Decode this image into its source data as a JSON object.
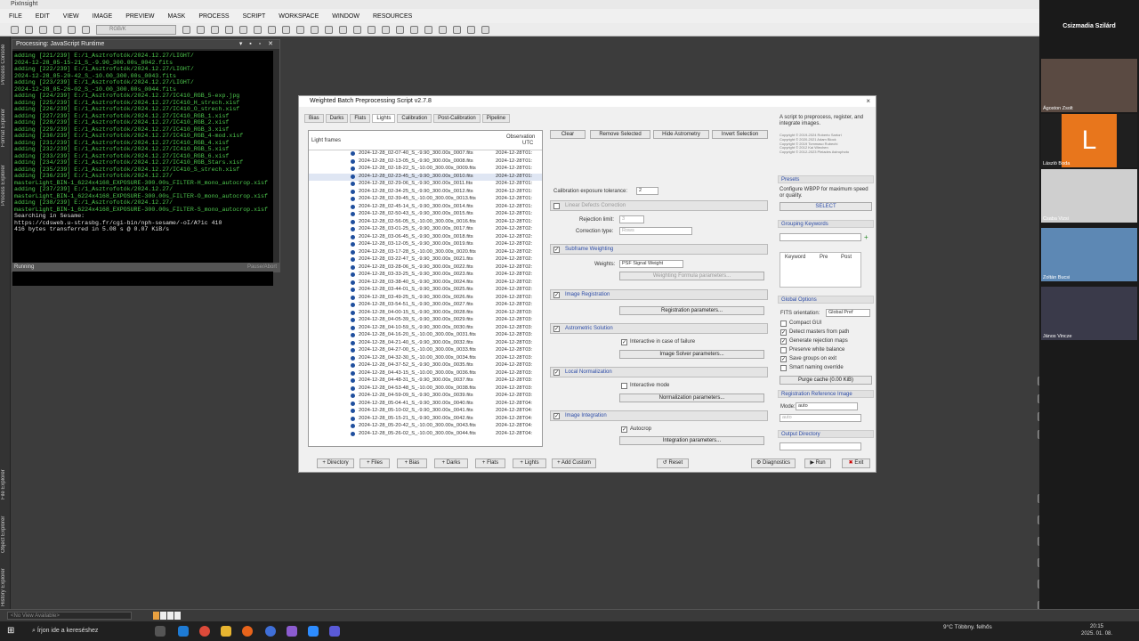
{
  "app": {
    "title": "PixInsight"
  },
  "menu": [
    "FILE",
    "EDIT",
    "VIEW",
    "IMAGE",
    "PREVIEW",
    "MASK",
    "PROCESS",
    "SCRIPT",
    "WORKSPACE",
    "WINDOW",
    "RESOURCES"
  ],
  "toolbar": {
    "channel_select": "RGB/K"
  },
  "left_tabs": [
    "Process Console",
    "Format Explorer",
    "Process Explorer",
    "File Explorer",
    "Object Explorer",
    "History Explorer"
  ],
  "console": {
    "title": "Processing: JavaScript Runtime",
    "lines": [
      "adding [221/239] E:/1_Asztrofotók/2024.12.27/LIGHT/",
      "2024-12-28_05-15-21_S_-9.90_300.00s_0042.fits",
      "adding [222/239] E:/1_Asztrofotók/2024.12.27/LIGHT/",
      "2024-12-28_05-20-42_S_-10.00_300.00s_0043.fits",
      "adding [223/239] E:/1_Asztrofotók/2024.12.27/LIGHT/",
      "2024-12-28_05-26-02_S_-10.00_300.00s_0044.fits",
      "adding [224/239] E:/1_Asztrofotók/2024.12.27/IC410_RGB_5-exp.jpg",
      "adding [225/239] E:/1_Asztrofotók/2024.12.27/IC410_H_strech.xisf",
      "adding [226/239] E:/1_Asztrofotók/2024.12.27/IC410_O_strech.xisf",
      "adding [227/239] E:/1_Asztrofotók/2024.12.27/IC410_RGB_1.xisf",
      "adding [228/239] E:/1_Asztrofotók/2024.12.27/IC410_RGB_2.xisf",
      "adding [229/239] E:/1_Asztrofotók/2024.12.27/IC410_RGB_3.xisf",
      "adding [230/239] E:/1_Asztrofotók/2024.12.27/IC410_RGB_4-mod.xisf",
      "adding [231/239] E:/1_Asztrofotók/2024.12.27/IC410_RGB_4.xisf",
      "adding [232/239] E:/1_Asztrofotók/2024.12.27/IC410_RGB_5.xisf",
      "adding [233/239] E:/1_Asztrofotók/2024.12.27/IC410_RGB_6.xisf",
      "adding [234/239] E:/1_Asztrofotók/2024.12.27/IC410_RGB_Stars.xisf",
      "adding [235/239] E:/1_Asztrofotók/2024.12.27/IC410_S_strech.xisf",
      "adding [236/239] E:/1_Asztrofotók/2024.12.27/",
      "masterLight_BIN-1_6224x4168_EXPOSURE-300.00s_FILTER-H_mono_autocrop.xisf",
      "adding [237/239] E:/1_Asztrofotók/2024.12.27/",
      "masterLight_BIN-1_6224x4168_EXPOSURE-300.00s_FILTER-O_mono_autocrop.xisf",
      "adding [238/239] E:/1_Asztrofotók/2024.12.27/",
      "masterLight_BIN-1_6224x4168_EXPOSURE-300.00s_FILTER-S_mono_autocrop.xisf",
      "",
      "Searching in Sesame:",
      "https://cdsweb.u-strasbg.fr/cgi-bin/nph-sesame/-oI/A?ic 410",
      "416 bytes transferred in 5.08 s @ 0.07 KiB/s"
    ],
    "status": "Running",
    "pause": "Pause/Abort"
  },
  "dialog": {
    "title": "Weighted Batch Preprocessing Script v2.7.8",
    "close": "×",
    "tabs": [
      "Bias",
      "Darks",
      "Flats",
      "Lights",
      "Calibration",
      "Post-Calibration",
      "Pipeline"
    ],
    "list_header": {
      "frames": "Light frames",
      "obs": "Observation",
      "utc": "UTC"
    },
    "frames": [
      [
        "2024-12-28_02-07-40_S_-9.90_300.00s_0007.fits",
        "2024-12-28T01:"
      ],
      [
        "2024-12-28_02-13-05_S_-9.90_300.00s_0008.fits",
        "2024-12-28T01:"
      ],
      [
        "2024-12-28_02-18-22_S_-10.00_300.00s_0009.fits",
        "2024-12-28T01:"
      ],
      [
        "2024-12-28_02-23-45_S_-9.90_300.00s_0010.fits",
        "2024-12-28T01:"
      ],
      [
        "2024-12-28_02-29-06_S_-9.90_300.00s_0011.fits",
        "2024-12-28T01:"
      ],
      [
        "2024-12-28_02-34-25_S_-9.90_300.00s_0012.fits",
        "2024-12-28T01:"
      ],
      [
        "2024-12-28_02-39-45_S_-10.00_300.00s_0013.fits",
        "2024-12-28T01:"
      ],
      [
        "2024-12-28_02-45-14_S_-9.90_300.00s_0014.fits",
        "2024-12-28T01:"
      ],
      [
        "2024-12-28_02-50-43_S_-9.90_300.00s_0015.fits",
        "2024-12-28T01:"
      ],
      [
        "2024-12-28_02-56-05_S_-10.00_300.00s_0016.fits",
        "2024-12-28T01:"
      ],
      [
        "2024-12-28_03-01-25_S_-9.90_300.00s_0017.fits",
        "2024-12-28T02:"
      ],
      [
        "2024-12-28_03-06-45_S_-9.90_300.00s_0018.fits",
        "2024-12-28T02:"
      ],
      [
        "2024-12-28_03-12-05_S_-9.90_300.00s_0019.fits",
        "2024-12-28T02:"
      ],
      [
        "2024-12-28_03-17-28_S_-10.00_300.00s_0020.fits",
        "2024-12-28T02:"
      ],
      [
        "2024-12-28_03-22-47_S_-9.90_300.00s_0021.fits",
        "2024-12-28T02:"
      ],
      [
        "2024-12-28_03-28-06_S_-9.90_300.00s_0022.fits",
        "2024-12-28T02:"
      ],
      [
        "2024-12-28_03-33-25_S_-9.90_300.00s_0023.fits",
        "2024-12-28T02:"
      ],
      [
        "2024-12-28_03-38-40_S_-9.90_300.00s_0024.fits",
        "2024-12-28T02:"
      ],
      [
        "2024-12-28_03-44-01_S_-9.90_300.00s_0025.fits",
        "2024-12-28T02:"
      ],
      [
        "2024-12-28_03-49-25_S_-9.90_300.00s_0026.fits",
        "2024-12-28T02:"
      ],
      [
        "2024-12-28_03-54-51_S_-9.90_300.00s_0027.fits",
        "2024-12-28T02:"
      ],
      [
        "2024-12-28_04-00-15_S_-9.90_300.00s_0028.fits",
        "2024-12-28T03:"
      ],
      [
        "2024-12-28_04-05-39_S_-9.90_300.00s_0029.fits",
        "2024-12-28T03:"
      ],
      [
        "2024-12-28_04-10-59_S_-9.90_300.00s_0030.fits",
        "2024-12-28T03:"
      ],
      [
        "2024-12-28_04-16-20_S_-10.00_300.00s_0031.fits",
        "2024-12-28T03:"
      ],
      [
        "2024-12-28_04-21-40_S_-9.90_300.00s_0032.fits",
        "2024-12-28T03:"
      ],
      [
        "2024-12-28_04-27-00_S_-10.00_300.00s_0033.fits",
        "2024-12-28T03:"
      ],
      [
        "2024-12-28_04-32-30_S_-10.00_300.00s_0034.fits",
        "2024-12-28T03:"
      ],
      [
        "2024-12-28_04-37-52_S_-9.90_300.00s_0035.fits",
        "2024-12-28T03:"
      ],
      [
        "2024-12-28_04-43-15_S_-10.00_300.00s_0036.fits",
        "2024-12-28T03:"
      ],
      [
        "2024-12-28_04-48-31_S_-9.90_300.00s_0037.fits",
        "2024-12-28T03:"
      ],
      [
        "2024-12-28_04-53-48_S_-10.00_300.00s_0038.fits",
        "2024-12-28T03:"
      ],
      [
        "2024-12-28_04-59-09_S_-9.90_300.00s_0039.fits",
        "2024-12-28T03:"
      ],
      [
        "2024-12-28_05-04-41_S_-9.90_300.00s_0040.fits",
        "2024-12-28T04:"
      ],
      [
        "2024-12-28_05-10-02_S_-9.90_300.00s_0041.fits",
        "2024-12-28T04:"
      ],
      [
        "2024-12-28_05-15-21_S_-9.90_300.00s_0042.fits",
        "2024-12-28T04:"
      ],
      [
        "2024-12-28_05-20-42_S_-10.00_300.00s_0043.fits",
        "2024-12-28T04:"
      ],
      [
        "2024-12-28_05-26-02_S_-10.00_300.00s_0044.fits",
        "2024-12-28T04:"
      ]
    ],
    "mid": {
      "clear": "Clear",
      "remove_selected": "Remove Selected",
      "hide_astrometry": "Hide Astrometry",
      "invert_selection": "Invert Selection",
      "cal_exposure_label": "Calibration exposure tolerance:",
      "cal_exposure_value": "2",
      "linear_defects": "Linear Defects Correction",
      "rejection_limit_label": "Rejection limit:",
      "rejection_limit_value": "3",
      "correction_type_label": "Correction type:",
      "correction_type_value": "Rows",
      "subframe_weighting": "Subframe Weighting",
      "weights_label": "Weights:",
      "weights_value": "PSF Signal Weight",
      "weighting_formula": "Weighting Formula parameters...",
      "image_registration": "Image Registration",
      "registration_params": "Registration parameters...",
      "astrometric_solution": "Astrometric Solution",
      "interactive_failure": "Interactive in case of failure",
      "image_solver_params": "Image Solver parameters...",
      "local_normalization": "Local Normalization",
      "interactive_mode": "Interactive mode",
      "normalization_params": "Normalization parameters...",
      "image_integration": "Image Integration",
      "autocrop": "Autocrop",
      "integration_params": "Integration parameters..."
    },
    "right": {
      "description": "A script to preprocess, register, and integrate images.",
      "copyright": [
        "Copyright © 2019-2024 Roberto Sartori",
        "Copyright © 2020-2021 Adam Block",
        "Copyright © 2019 Tommaso Rubechi",
        "Copyright © 2012 Kai Wiechen",
        "Copyright © 2012-2023 Pleiades Astrophoto"
      ],
      "presets": "Presets",
      "presets_desc": "Configure WBPP for maximum speed or quality.",
      "select": "SELECT",
      "grouping_keywords": "Grouping Keywords",
      "kw_cols": [
        "Keyword",
        "Pre",
        "Post"
      ],
      "global_options": "Global Options",
      "fits_orientation_label": "FITS orientation:",
      "fits_orientation_value": "Global Pref",
      "options": [
        {
          "label": "Compact GUI",
          "checked": false
        },
        {
          "label": "Detect masters from path",
          "checked": true
        },
        {
          "label": "Generate rejection maps",
          "checked": true
        },
        {
          "label": "Preserve white balance",
          "checked": false
        },
        {
          "label": "Save groups on exit",
          "checked": true
        },
        {
          "label": "Smart naming override",
          "checked": false
        }
      ],
      "purge_cache": "Purge cache (0.00 KiB)",
      "reg_ref_image": "Registration Reference Image",
      "mode_label": "Mode:",
      "mode_value": "auto",
      "mode_input": "auto",
      "output_directory": "Output Directory"
    },
    "bottom": {
      "directory": "Directory",
      "files": "Files",
      "bias": "Bias",
      "darks": "Darks",
      "flats": "Flats",
      "lights": "Lights",
      "add_custom": "Add Custom",
      "reset": "Reset",
      "diagnostics": "Diagnostics",
      "run": "Run",
      "exit": "Exit"
    }
  },
  "workspace_icons_top": [
    "MaskedStretch",
    "LinearFit",
    "LRGBCombination",
    "PixelMath"
  ],
  "workspace_icons_bottom": [
    "IntegerResample",
    "GeneralizedHyperbolicStretch",
    "ColorSaturation",
    "CurvesTransformation",
    "HistogramTransformation",
    "ScreenTransferFunction"
  ],
  "video": {
    "host": "Csizmadia Szilárd",
    "participants": [
      "Ágoston Zsolt",
      "László Boda",
      "Csaba Vizsi",
      "Zoltán Bucsi",
      "János Vincze"
    ],
    "avatar_letter": "L"
  },
  "statusbar": {
    "view": "<No View Available>"
  },
  "taskbar": {
    "search_placeholder": "Írjon ide a kereséshez",
    "weather": "9°C  Többny. felhős",
    "time": "20:15",
    "date": "2025. 01. 08."
  }
}
